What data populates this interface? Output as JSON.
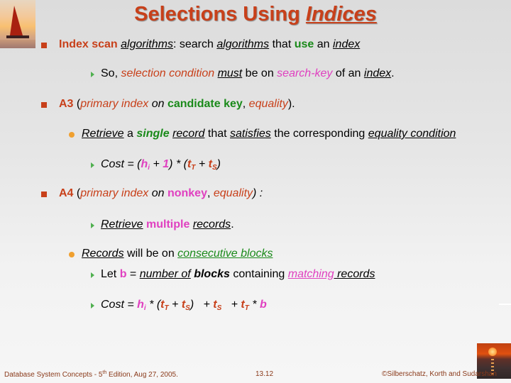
{
  "slide": {
    "title_part1": "Selections Using ",
    "title_part2": "Indices"
  },
  "bullets": {
    "l1": {
      "a": "Index scan ",
      "b": "algorithms",
      "c": ": search ",
      "d": "algorithms",
      "e": " that ",
      "f": "use",
      "g": " an ",
      "h": "index"
    },
    "l2": {
      "a": "So, ",
      "b": "selection condition",
      "c": " ",
      "d": "must",
      "e": " be on ",
      "f": "search-key",
      "g": " of an ",
      "h": "index",
      "i": "."
    },
    "l3": {
      "a": "A3",
      "b": " (",
      "c": "primary index",
      "d": " on ",
      "e": "candidate key",
      "f": ", ",
      "g": "equality",
      "h": ")."
    },
    "l4": {
      "a": "Retrieve",
      "b": " a ",
      "c": "single",
      "d": " ",
      "e": "record",
      "f": " that ",
      "g": "satisfies",
      "h": " the corresponding ",
      "i": "equality condition"
    },
    "l5": {
      "a": "Cost = (",
      "b": "h",
      "b_sub": "i",
      "c": " + ",
      "d": "1",
      "e": ") * (",
      "f": "t",
      "f_sub": "T",
      "g": " + ",
      "h": "t",
      "h_sub": "S",
      "i": ")"
    },
    "l6": {
      "a": "A4",
      "b": " (",
      "c": "primary index",
      "d": " on ",
      "e": "nonkey",
      "f": ", ",
      "g": "equality",
      "h": ") :"
    },
    "l7": {
      "a": "Retrieve",
      "b": " ",
      "c": "multiple",
      "d": " ",
      "e": "records",
      "f": "."
    },
    "l8": {
      "a": "Records",
      "b": " will be on ",
      "c": "consecutive blocks"
    },
    "l9": {
      "a": "Let ",
      "b": "b",
      "c": " = ",
      "d": "number of",
      "e": " ",
      "f": "blocks",
      "g": " containing ",
      "h": "matching",
      "i": " records"
    },
    "l10": {
      "a": "Cost = ",
      "b": "h",
      "b_sub": "i",
      "c": " * (",
      "d": "t",
      "d_sub": "T",
      "e": " + ",
      "f": "t",
      "f_sub": "S",
      "g": ")   + ",
      "h": "t",
      "h_sub": "S",
      "i": "   + ",
      "j": "t",
      "j_sub": "T",
      "k": " * ",
      "l": "b"
    }
  },
  "footer": {
    "left_a": "Database System Concepts - 5",
    "left_sup": "th",
    "left_b": " Edition, Aug 27, 2005.",
    "page": "13.12",
    "right": "©Silberschatz, Korth and Sudarshan"
  },
  "colors": {
    "accent_red": "#c8401a",
    "green": "#1a8a1a",
    "pink": "#e040c0",
    "orange_bullet": "#f0a030",
    "green_bullet": "#50b050"
  }
}
